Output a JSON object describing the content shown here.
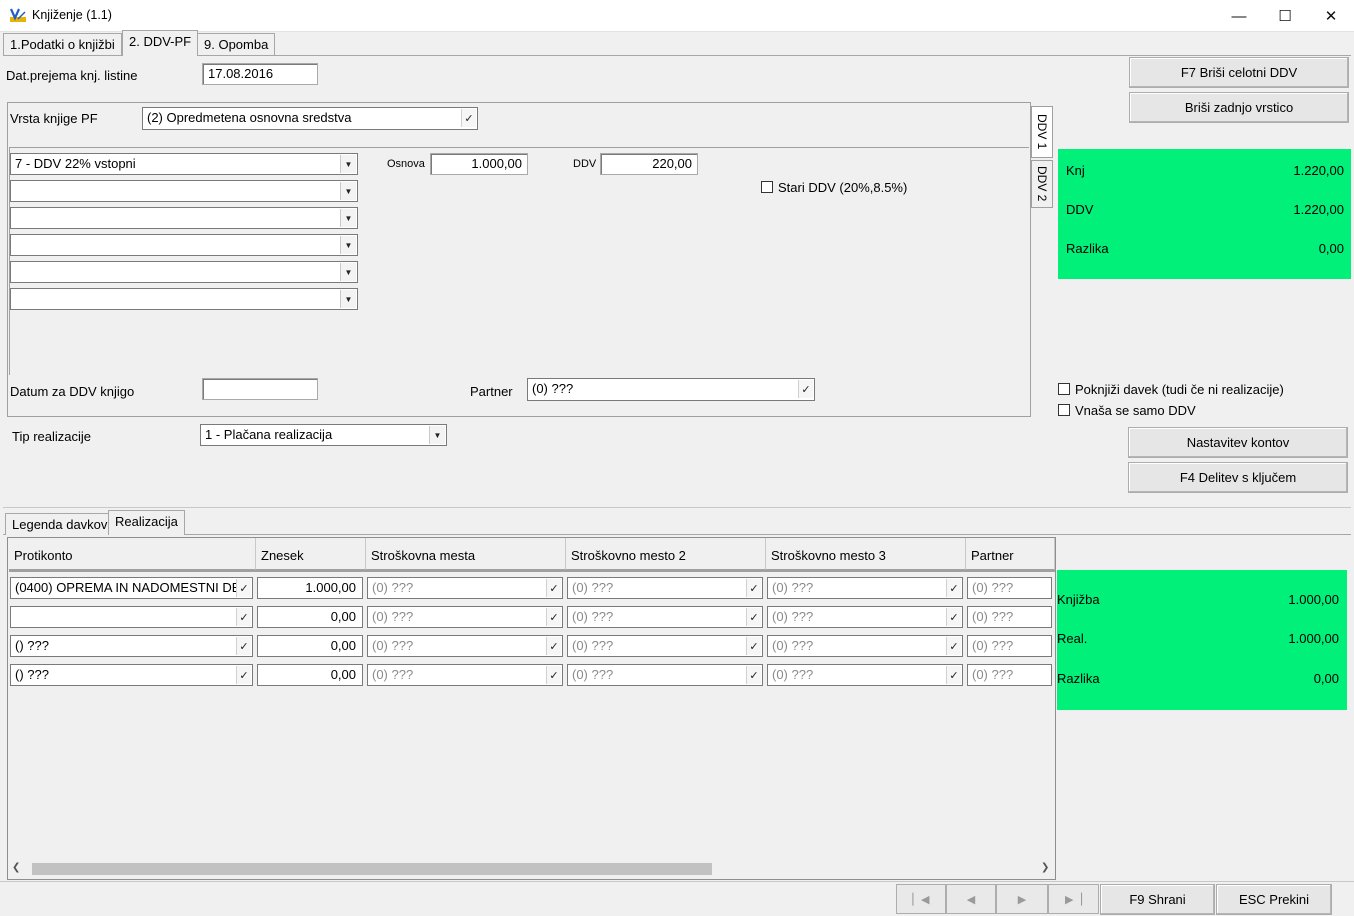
{
  "window": {
    "title": "Knjiženje  (1.1)",
    "minimize_glyph": "—",
    "maximize_glyph": "☐",
    "close_glyph": "✕"
  },
  "tabs": [
    {
      "label": "1.Podatki o knjižbi"
    },
    {
      "label": "2. DDV-PF"
    },
    {
      "label": "9. Opomba"
    }
  ],
  "header": {
    "date_label": "Dat.prejema knj. listine",
    "date_value": "17.08.2016"
  },
  "ddv_panel": {
    "book_type_label": "Vrsta knjige PF",
    "book_type_value": "(2) Opredmetena osnovna sredstva",
    "vtabs": [
      "DDV 1",
      "DDV 2"
    ],
    "tax_rows": [
      "7 - DDV 22% vstopni",
      "",
      "",
      "",
      "",
      ""
    ],
    "osnova_label": "Osnova",
    "osnova_value": "1.000,00",
    "ddv_label": "DDV",
    "ddv_value": "220,00",
    "old_ddv_label": "Stari DDV (20%,8.5%)",
    "datum_label": "Datum za DDV knjigo",
    "datum_value": "",
    "partner_label": "Partner",
    "partner_value": "(0) ???"
  },
  "summary_top": {
    "rows": [
      {
        "label": "Knj",
        "value": "1.220,00"
      },
      {
        "label": "DDV",
        "value": "1.220,00"
      },
      {
        "label": "Razlika",
        "value": "0,00"
      }
    ]
  },
  "buttons": {
    "delete_all": "F7 Briši celotni DDV",
    "delete_last": "Briši zadnjo vrstico",
    "account_settings": "Nastavitev kontov",
    "split_key": "F4 Delitev s ključem",
    "save": "F9 Shrani",
    "cancel": "ESC Prekini"
  },
  "options": {
    "post_tax": "Poknjiži davek (tudi če ni realizacije)",
    "only_ddv": "Vnaša se samo DDV"
  },
  "realization": {
    "label": "Tip realizacije",
    "value": "1 - Plačana realizacija"
  },
  "bottom_tabs": [
    "Legenda davkov",
    "Realizacija"
  ],
  "grid": {
    "columns": [
      "Protikonto",
      "Znesek",
      "Stroškovna mesta",
      "Stroškovno mesto 2",
      "Stroškovno mesto 3",
      "Partner"
    ],
    "rows": [
      [
        "(0400) OPREMA IN NADOMESTNI DE",
        "1.000,00",
        "(0) ???",
        "(0) ???",
        "(0) ???",
        "(0) ???"
      ],
      [
        "",
        "0,00",
        "(0) ???",
        "(0) ???",
        "(0) ???",
        "(0) ???"
      ],
      [
        "() ???",
        "0,00",
        "(0) ???",
        "(0) ???",
        "(0) ???",
        "(0) ???"
      ],
      [
        "() ???",
        "0,00",
        "(0) ???",
        "(0) ???",
        "(0) ???",
        "(0) ???"
      ]
    ]
  },
  "summary_bottom": {
    "rows": [
      {
        "label": "Knjižba",
        "value": "1.000,00"
      },
      {
        "label": "Real.",
        "value": "1.000,00"
      },
      {
        "label": "Razlika",
        "value": "0,00"
      }
    ]
  },
  "colors": {
    "summary_green": "#00f07a",
    "window_bg": "#f0f0f0"
  }
}
